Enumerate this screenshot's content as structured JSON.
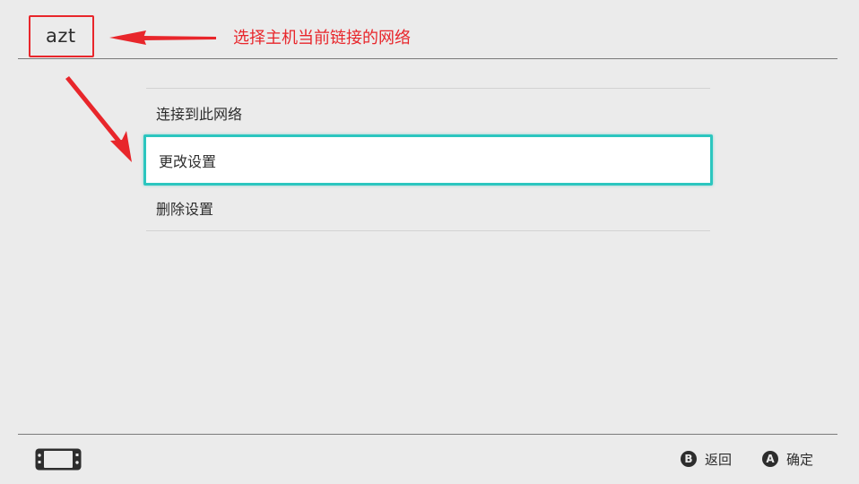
{
  "header": {
    "title": "azt"
  },
  "annotation": {
    "text": "选择主机当前链接的网络",
    "color": "#e8262b"
  },
  "menu": {
    "items": [
      {
        "label": "连接到此网络",
        "selected": false
      },
      {
        "label": "更改设置",
        "selected": true
      },
      {
        "label": "删除设置",
        "selected": false
      }
    ]
  },
  "footer": {
    "back": {
      "button": "B",
      "label": "返回"
    },
    "confirm": {
      "button": "A",
      "label": "确定"
    }
  },
  "colors": {
    "background": "#ebebeb",
    "accent": "#2cc6bf",
    "annotation": "#e8262b"
  },
  "icons": {
    "console": "console-handheld-icon"
  }
}
